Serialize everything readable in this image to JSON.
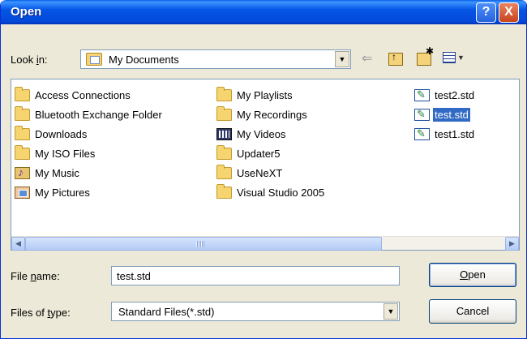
{
  "dialog": {
    "title": "Open",
    "help_glyph": "?",
    "close_glyph": "X"
  },
  "look_in": {
    "label_prefix": "Look ",
    "label_accel": "i",
    "label_suffix": "n:",
    "value": "My Documents"
  },
  "toolbar": {
    "icons": [
      "back-arrow-icon",
      "up-folder-icon",
      "new-folder-icon",
      "views-menu-icon"
    ]
  },
  "file_list": {
    "items": [
      {
        "label": "Access Connections",
        "icon": "folder-icon",
        "selected": false
      },
      {
        "label": "Bluetooth Exchange Folder",
        "icon": "folder-icon",
        "selected": false
      },
      {
        "label": "Downloads",
        "icon": "folder-icon",
        "selected": false
      },
      {
        "label": "My ISO Files",
        "icon": "folder-icon",
        "selected": false
      },
      {
        "label": "My Music",
        "icon": "music-folder-icon",
        "selected": false
      },
      {
        "label": "My Pictures",
        "icon": "pictures-folder-icon",
        "selected": false
      },
      {
        "label": "My Playlists",
        "icon": "folder-icon",
        "selected": false
      },
      {
        "label": "My Recordings",
        "icon": "folder-icon",
        "selected": false
      },
      {
        "label": "My Videos",
        "icon": "video-folder-icon",
        "selected": false
      },
      {
        "label": "Updater5",
        "icon": "folder-icon",
        "selected": false
      },
      {
        "label": "UseNeXT",
        "icon": "folder-icon",
        "selected": false
      },
      {
        "label": "Visual Studio 2005",
        "icon": "folder-icon",
        "selected": false
      },
      {
        "label": "test2.std",
        "icon": "std-file-icon",
        "selected": false
      },
      {
        "label": "test.std",
        "icon": "std-file-icon",
        "selected": true
      },
      {
        "label": "test1.std",
        "icon": "std-file-icon",
        "selected": false
      }
    ]
  },
  "file_name": {
    "label_prefix": "File ",
    "label_accel": "n",
    "label_suffix": "ame:",
    "value": "test.std"
  },
  "file_type": {
    "label_prefix": "Files of ",
    "label_accel": "t",
    "label_suffix": "ype:",
    "value": "Standard Files(*.std)"
  },
  "buttons": {
    "open_accel": "O",
    "open_rest": "pen",
    "cancel": "Cancel"
  },
  "colors": {
    "title_bar": "#0555E5",
    "selection": "#316AC5",
    "dialog_bg": "#ECE9D8"
  }
}
